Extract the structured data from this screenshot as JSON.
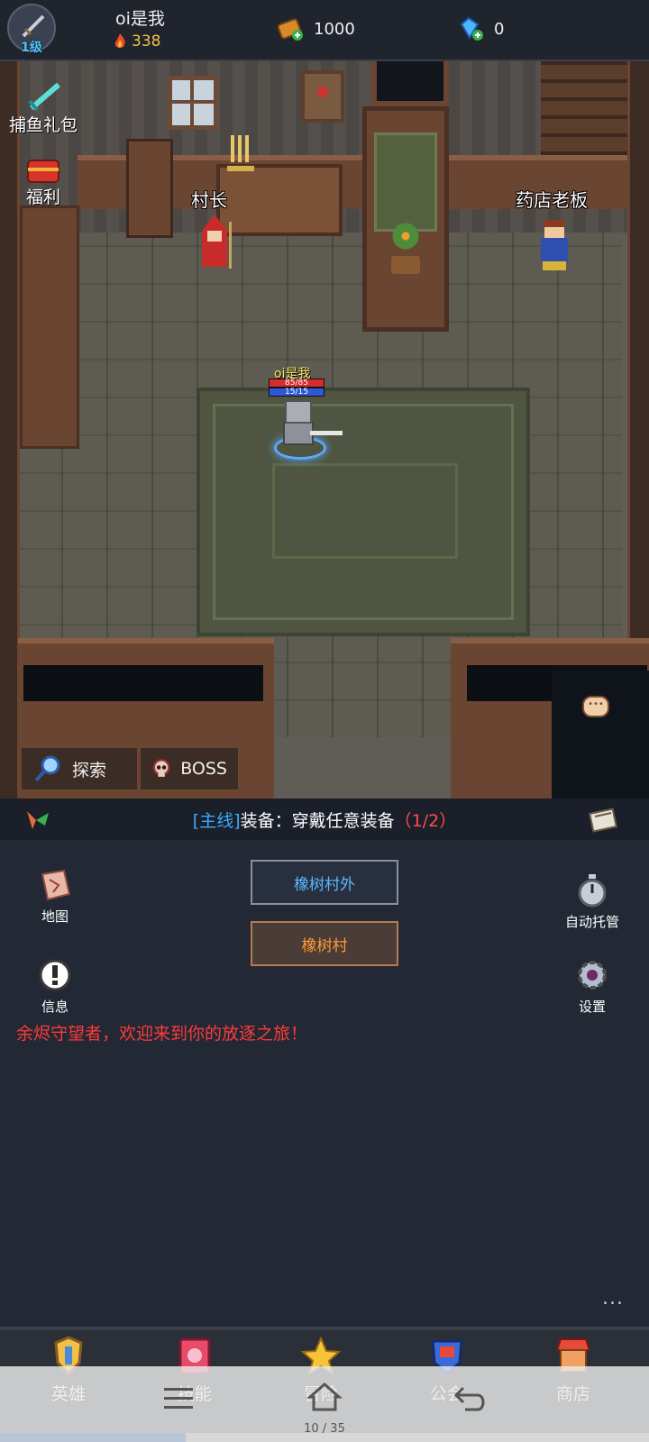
{
  "player": {
    "name": "oi是我",
    "level": "1级",
    "power": "338"
  },
  "currency": {
    "gold": "1000",
    "gems": "0"
  },
  "scene": {
    "side_buttons": {
      "gift": "捕鱼礼包",
      "welfare": "福利"
    },
    "npcs": {
      "chief": "村长",
      "pharmacist": "药店老板"
    },
    "hero": {
      "name": "oi是我",
      "hp": "85/85",
      "mp": "15/15"
    },
    "explore": "探索",
    "boss": "BOSS"
  },
  "quest": {
    "tag": "[主线]",
    "text": "装备：穿戴任意装备",
    "progress": "（1/2）"
  },
  "panel": {
    "location_outside": "橡树村外",
    "location_current": "橡树村",
    "tools": {
      "map": "地图",
      "info": "信息",
      "auto": "自动托管",
      "settings": "设置"
    },
    "welcome": "余烬守望者，欢迎来到你的放逐之旅！",
    "more": "..."
  },
  "nav": {
    "hero": "英雄",
    "skill": "技能",
    "main": "冒险",
    "guild": "公会",
    "shop": "商店"
  },
  "system": {
    "page_indicator": "10 / 35",
    "page_progress": 0.2857
  },
  "colors": {
    "quest_tag": "#3fa9ff",
    "quest_progress": "#ff4d4d",
    "welcome_text": "#ff3a3a",
    "location_outside": "#5ab8ff",
    "location_current": "#ff9a3a"
  }
}
